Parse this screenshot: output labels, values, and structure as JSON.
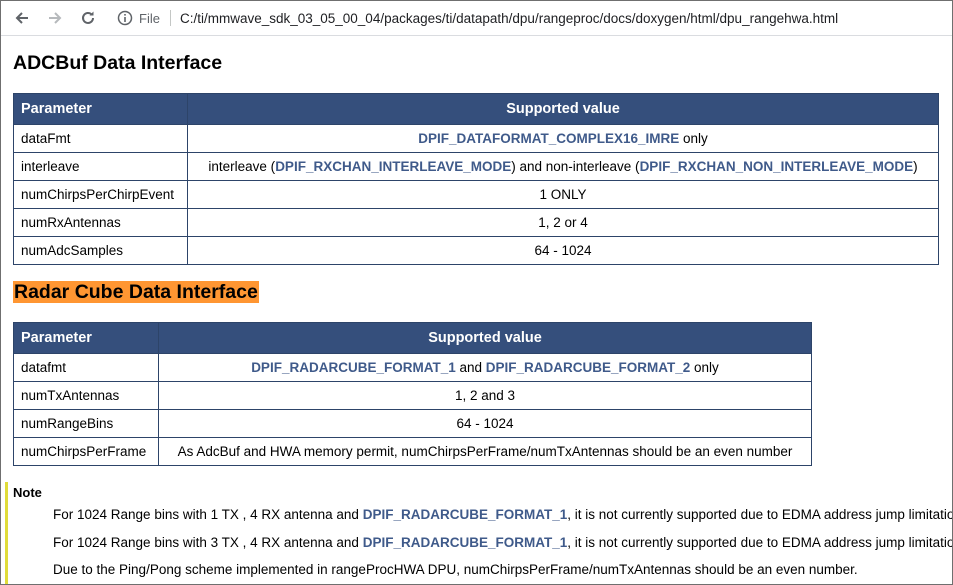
{
  "browser": {
    "file_label": "File",
    "url": "C:/ti/mmwave_sdk_03_05_00_04/packages/ti/datapath/dpu/rangeproc/docs/doxygen/html/dpu_rangehwa.html"
  },
  "adcbuf": {
    "heading": "ADCBuf Data Interface",
    "header_param": "Parameter",
    "header_value": "Supported value",
    "rows": [
      {
        "param": "dataFmt",
        "parts": [
          "DPIF_DATAFORMAT_COMPLEX16_IMRE",
          " only"
        ]
      },
      {
        "param": "interleave",
        "parts": [
          "interleave (",
          "DPIF_RXCHAN_INTERLEAVE_MODE",
          ") and non-interleave (",
          "DPIF_RXCHAN_NON_INTERLEAVE_MODE",
          ")"
        ]
      },
      {
        "param": "numChirpsPerChirpEvent",
        "parts": [
          "1 ONLY"
        ]
      },
      {
        "param": "numRxAntennas",
        "parts": [
          "1, 2 or 4"
        ]
      },
      {
        "param": "numAdcSamples",
        "parts": [
          "64 - 1024"
        ]
      }
    ]
  },
  "radarcube": {
    "heading": "Radar Cube Data Interface",
    "header_param": "Parameter",
    "header_value": "Supported value",
    "rows": [
      {
        "param": "datafmt",
        "parts": [
          "DPIF_RADARCUBE_FORMAT_1",
          " and ",
          "DPIF_RADARCUBE_FORMAT_2",
          " only"
        ]
      },
      {
        "param": "numTxAntennas",
        "parts": [
          "1, 2 and 3"
        ]
      },
      {
        "param": "numRangeBins",
        "parts": [
          "64 - 1024"
        ]
      },
      {
        "param": "numChirpsPerFrame",
        "parts": [
          "As AdcBuf and HWA memory permit, numChirpsPerFrame/numTxAntennas should be an even number"
        ]
      }
    ]
  },
  "note": {
    "title": "Note",
    "line1": [
      "For 1024 Range bins with 1 TX , 4 RX antenna and ",
      "DPIF_RADARCUBE_FORMAT_1",
      ", it is not currently supported due to EDMA address jump limitation."
    ],
    "line2": [
      "For 1024 Range bins with 3 TX , 4 RX antenna and ",
      "DPIF_RADARCUBE_FORMAT_1",
      ", it is not currently supported due to EDMA address jump limitation."
    ],
    "line3": "Due to the Ping/Pong scheme implemented in rangeProcHWA DPU, numChirpsPerFrame/numTxAntennas should be an even number."
  },
  "colors": {
    "table_header": "#354f7c",
    "code_link": "#3f5a8a",
    "heading_highlight": "#ff9632",
    "note_bar": "#e0dc3a"
  }
}
